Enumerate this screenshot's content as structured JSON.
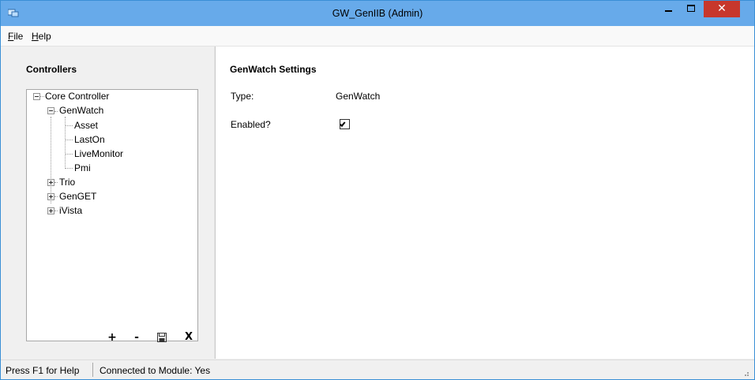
{
  "window": {
    "title": "GW_GenIIB (Admin)",
    "close_glyph": "✕"
  },
  "menu": {
    "file_label": "File",
    "help_label": "Help"
  },
  "controllers_panel": {
    "heading": "Controllers",
    "tree": {
      "root": "Core Controller",
      "genwatch": "GenWatch",
      "genwatch_children": [
        "Asset",
        "LastOn",
        "LiveMonitor",
        "Pmi"
      ],
      "trio": "Trio",
      "genget": "GenGET",
      "ivista": "iVista"
    },
    "toolbar": {
      "add_label": "+",
      "remove_label": "-",
      "delete_label": "X"
    }
  },
  "settings_panel": {
    "heading": "GenWatch Settings",
    "type_label": "Type:",
    "type_value": "GenWatch",
    "enabled_label": "Enabled?",
    "enabled_checked": true
  },
  "status": {
    "help_hint": "Press F1 for Help",
    "connection": "Connected to Module: Yes"
  },
  "colors": {
    "titlebar": "#67aaea",
    "close_button": "#c7372c",
    "panel_bg": "#f0f0f0"
  }
}
